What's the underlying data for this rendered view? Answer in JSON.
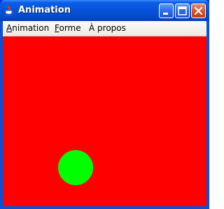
{
  "window": {
    "title": "Animation"
  },
  "titlebar_buttons": {
    "minimize": "minimize-icon",
    "maximize": "maximize-icon",
    "close": "close-icon"
  },
  "menubar": {
    "items": [
      {
        "mnemonic": "A",
        "rest": "nimation"
      },
      {
        "mnemonic": "F",
        "rest": "orme"
      },
      {
        "mnemonic": "À",
        "rest": " propos"
      }
    ]
  },
  "canvas": {
    "background_color": "#ff0000",
    "ball_color": "#00ff00"
  }
}
